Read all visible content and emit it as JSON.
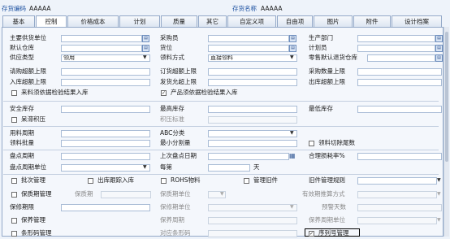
{
  "header": {
    "code_label": "存货编码",
    "code_value": "AAAAA",
    "name_label": "存货名称",
    "name_value": "AAAAA"
  },
  "tabs": [
    "基本",
    "控制",
    "价格成本",
    "计划",
    "质量",
    "其它",
    "自定义项",
    "自由项",
    "图片",
    "附件",
    "设计档案"
  ],
  "active_tab": "控制",
  "fields": {
    "main_supplier": "主要供货单位",
    "buyer": "采购员",
    "production_dept": "生产部门",
    "default_warehouse": "默认仓库",
    "location": "货位",
    "planner": "计划员",
    "supply_type": "供应类型",
    "supply_type_value": "领用",
    "picking_method": "领料方式",
    "picking_method_value": "直接领料",
    "zero_return_wh": "零售默认退货仓库",
    "requisition_limit": "请购超额上限",
    "order_limit": "订货超额上限",
    "purchase_qty_limit": "采购数量上限",
    "inbound_limit": "入库超额上限",
    "shipment_limit": "发货允超上限",
    "outbound_limit": "出库超额上限",
    "inbound_inspect": "来料须依据检验结果入库",
    "product_inspect": "产品须依据检验结果入库",
    "product_inspect_checked": "✓",
    "safety_stock": "安全库存",
    "max_stock": "最高库存",
    "min_stock": "最低库存",
    "overstock": "呆滞积压",
    "overstock_std": "积压标准",
    "usage_cycle": "用料周期",
    "abc_class": "ABC分类",
    "picking_batch": "领料批量",
    "min_split": "最小分割量",
    "picking_cut_tail": "领料切除尾数",
    "count_cycle": "盘点周期",
    "last_count_date": "上次盘点日期",
    "reasonable_loss": "合理损耗率%",
    "count_cycle_unit": "盘点周期单位",
    "every_week": "每第",
    "day": "天",
    "batch_mgmt": "批次管理",
    "outbound_trace": "出库跟踪入库",
    "rohs": "ROHS物料",
    "obsolete_mgmt": "管理旧件",
    "obsolete_rule": "旧件管理规则",
    "shelf_life_mgmt": "保质期管理",
    "shelf_life": "保质期",
    "shelf_life_unit": "保质期单位",
    "expiry_display": "有效期推算方式",
    "maint_period": "保修期限",
    "maint_period_unit": "保修期单位",
    "warning_days": "预警天数",
    "maintenance_mgmt": "保养管理",
    "maintenance_cycle": "保养周期",
    "maintenance_unit": "保养周期单位",
    "barcode_mgmt": "条形码管理",
    "barcode_label": "对应条形码",
    "serial_mgmt": "序列号管理",
    "serial_checked": "✓"
  },
  "icons": {
    "ref": "ref-browse-icon",
    "dropdown": "chevron-down-icon",
    "calendar": "calendar-icon"
  },
  "colors": {
    "accent": "#1a4fa0",
    "panel_bg": "#f4f7fc",
    "border": "#a9bcd6"
  }
}
